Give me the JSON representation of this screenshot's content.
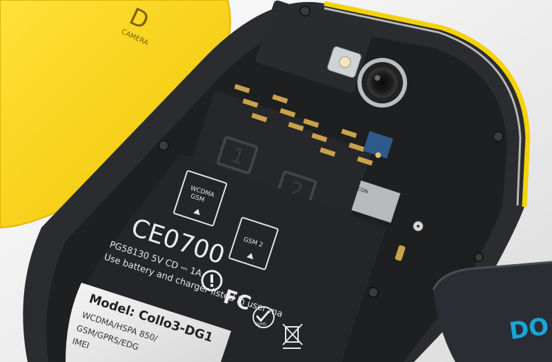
{
  "photo": {
    "back_cover": {
      "color": "#f5d20a",
      "fragment": "D",
      "fragment_sub": "CAMERA"
    },
    "phone": {
      "body_color": "#1e1f21",
      "frame_color": "#2a2b2e",
      "accent_color": "#f5d20a",
      "slot_1": "1",
      "slot_2": "2",
      "sim_card_1": {
        "line1": "WCDMA",
        "line2": "GSM"
      },
      "sim_card_2": {
        "line1": "GSM 2"
      },
      "ce_mark": "CE0700",
      "model_code": "PG58130  5V CD ⎓ 1A",
      "usage_note": "Use battery and charger listed in user ma",
      "fcc_mark": "FC",
      "rohs_mark": "RoHS",
      "label_sticker": {
        "model": "Model: Collo3-DG1",
        "line2": "WCDMA/HSPA 850/",
        "line3": "GSM/GPRS/EDG",
        "line4": "IMEI"
      },
      "tf_card_tag": "ICON"
    },
    "battery": {
      "color": "#2a2d33",
      "brand_fragment": "DO",
      "brand_color": "#1aa4d8"
    }
  }
}
